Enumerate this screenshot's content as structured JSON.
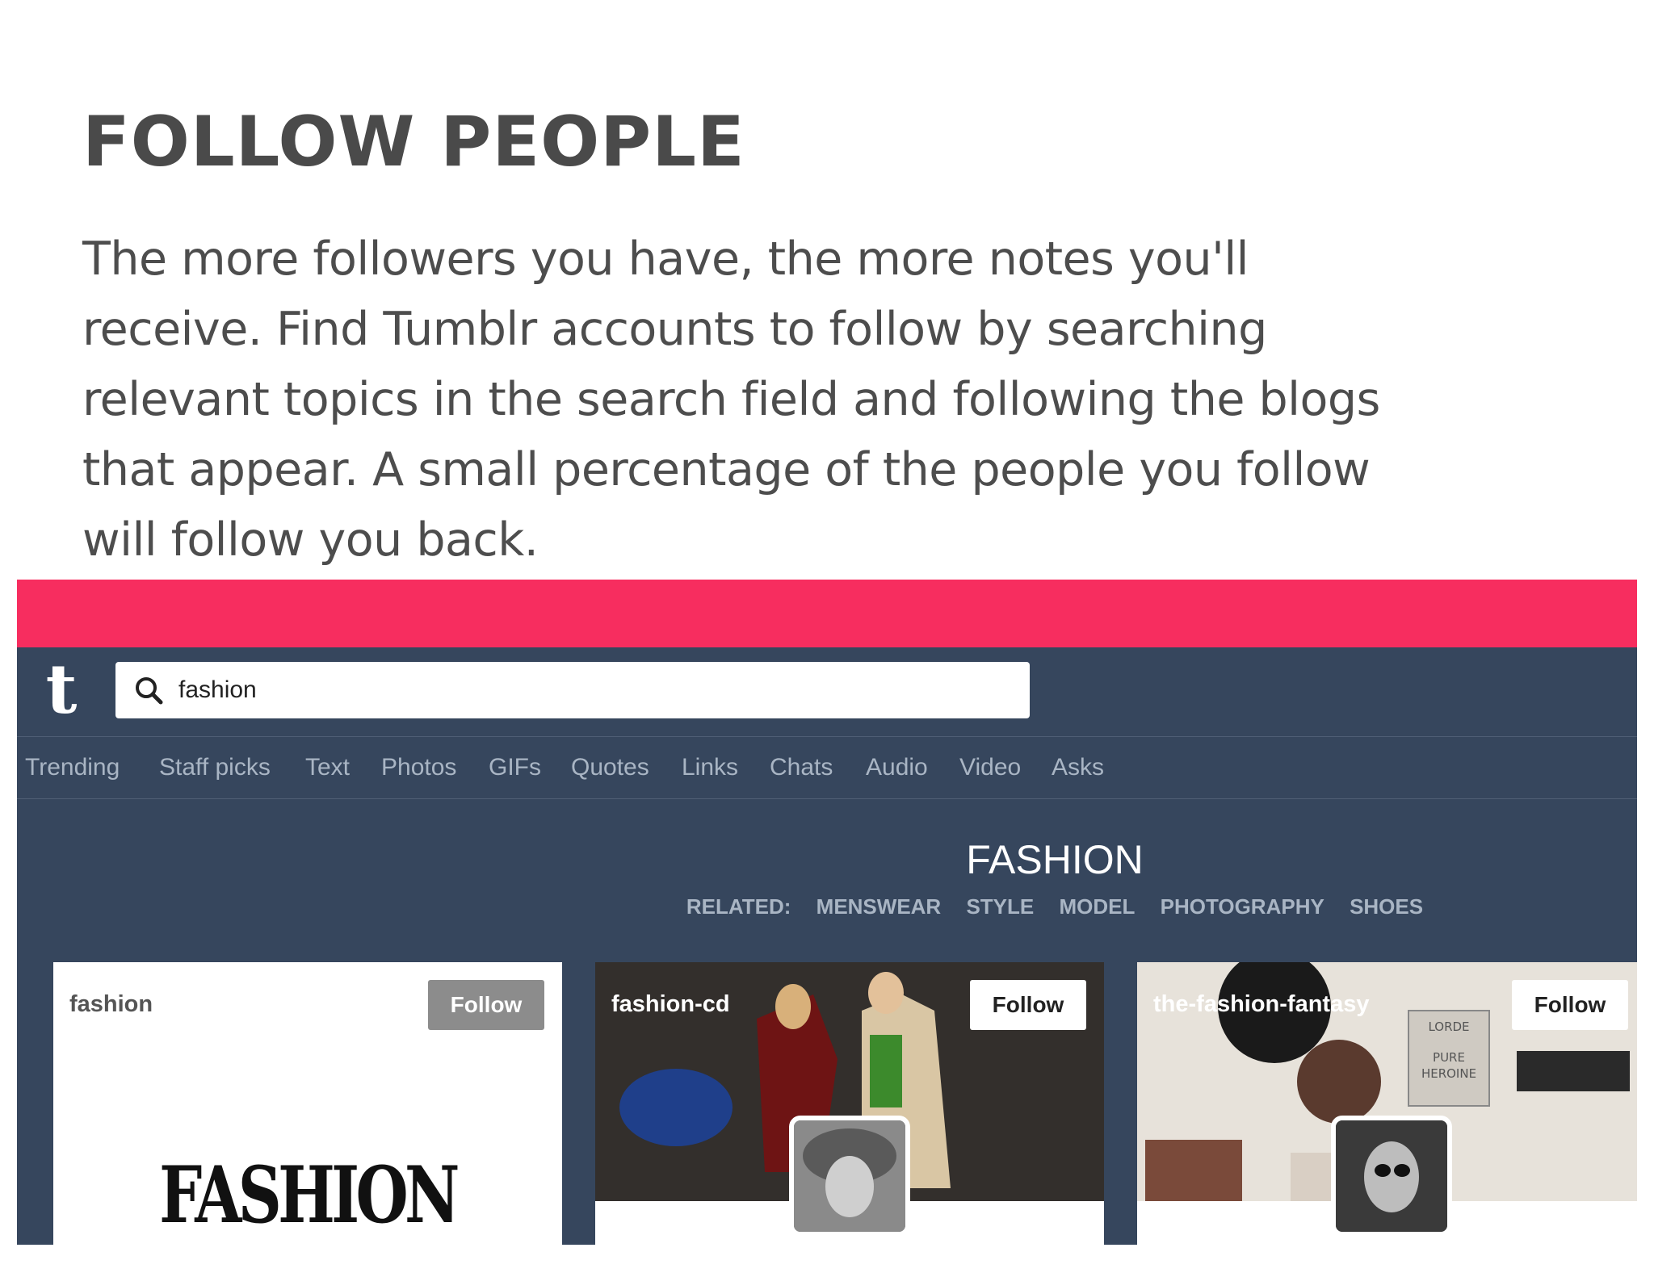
{
  "heading": "FOLLOW PEOPLE",
  "paragraph": "The more followers you have, the more notes you'll receive. Find Tumblr accounts to follow by searching relevant topics in the search field and following the blogs that appear. A small percentage of the people you follow will follow you back.",
  "app": {
    "logo": "t",
    "search": {
      "value": "fashion"
    },
    "tabs": [
      "Trending",
      "Staff picks",
      "Text",
      "Photos",
      "GIFs",
      "Quotes",
      "Links",
      "Chats",
      "Audio",
      "Video",
      "Asks"
    ],
    "category": {
      "title": "FASHION",
      "related_label": "RELATED:",
      "related": [
        "MENSWEAR",
        "STYLE",
        "MODEL",
        "PHOTOGRAPHY",
        "SHOES"
      ]
    },
    "cards": [
      {
        "name": "fashion",
        "follow_label": "Follow",
        "logo_text": "FASHION"
      },
      {
        "name": "fashion-cd",
        "follow_label": "Follow"
      },
      {
        "name": "the-fashion-fantasy",
        "follow_label": "Follow",
        "poster_lines": [
          "LORDE",
          "PURE",
          "HEROINE"
        ]
      }
    ]
  },
  "colors": {
    "pink_bar": "#f72d5f",
    "dashboard_bg": "#36465d",
    "tab_text": "#a9b5c4"
  }
}
